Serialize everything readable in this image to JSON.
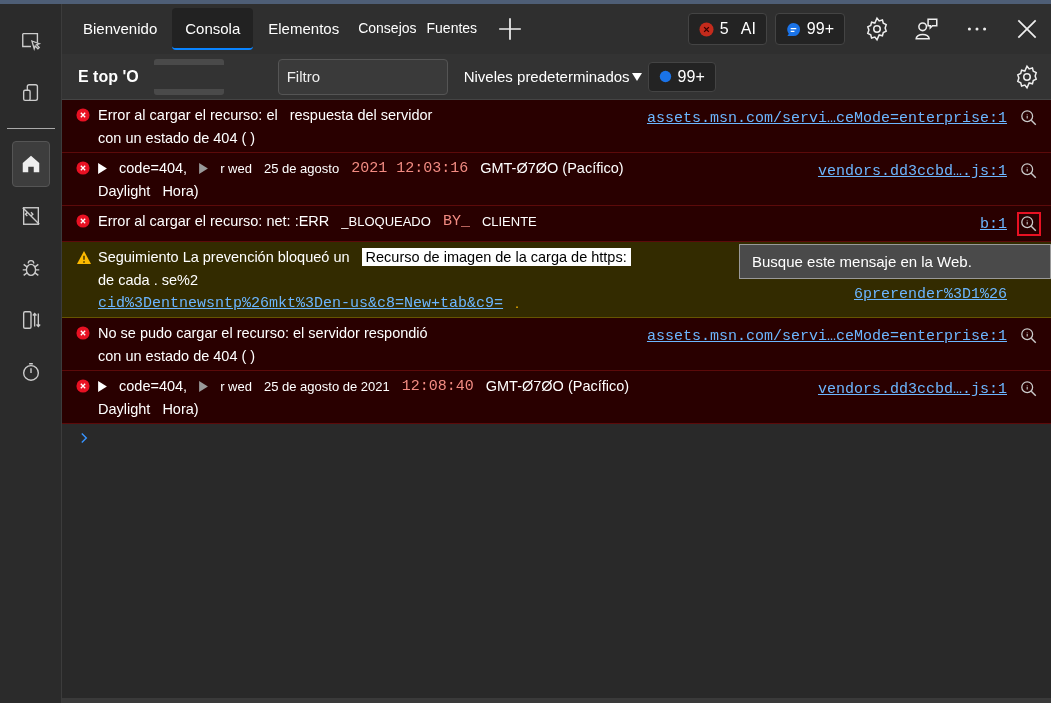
{
  "sidebar": {
    "items": [
      {
        "kind": "inspect",
        "selected": false
      },
      {
        "kind": "device",
        "selected": false
      },
      {
        "kind": "home",
        "selected": true
      },
      {
        "kind": "elements",
        "selected": false
      },
      {
        "kind": "bug",
        "selected": false
      },
      {
        "kind": "network",
        "selected": false
      },
      {
        "kind": "performance",
        "selected": false
      }
    ]
  },
  "tabs": [
    {
      "label": "Bienvenido",
      "selected": false
    },
    {
      "label": "Consola",
      "selected": true
    },
    {
      "label": "Elementos",
      "selected": false
    },
    {
      "label": "Consejos",
      "selected": false
    },
    {
      "label": "Fuentes",
      "selected": false
    }
  ],
  "error_badge": {
    "count": "5",
    "label": "AI"
  },
  "message_badge": {
    "count": "99+"
  },
  "toolbar": {
    "context": "E top 'O",
    "filter_placeholder": "Filtro",
    "levels": "Niveles predeterminados",
    "levels_badge": "99+"
  },
  "messages": [
    {
      "kind": "error",
      "search_focused": false,
      "source": "assets.msn.com/servi…ceMode=enterprise:1",
      "lines": [
        [
          {
            "kind": "text",
            "text": "Error al cargar el recurso: el"
          },
          {
            "kind": "text",
            "text": "respuesta del servidor"
          }
        ],
        [
          {
            "kind": "text",
            "text": "con un estado de 404 ( )"
          }
        ]
      ]
    },
    {
      "kind": "error",
      "search_focused": false,
      "source": "vendors.dd3ccbd….js:1",
      "lines": [
        [
          {
            "kind": "expander"
          },
          {
            "kind": "text",
            "text": "code=404,"
          },
          {
            "kind": "expander-dim"
          },
          {
            "kind": "small",
            "text": "r wed"
          },
          {
            "kind": "small",
            "text": "25 de agosto"
          },
          {
            "kind": "date",
            "text": "2021 12:03:16"
          },
          {
            "kind": "text",
            "text": "GMT-Ø7ØO (Pacífico)"
          }
        ],
        [
          {
            "kind": "text",
            "text": "Daylight"
          },
          {
            "kind": "text",
            "text": "Hora)"
          }
        ]
      ]
    },
    {
      "kind": "error",
      "search_focused": true,
      "source": "b:1",
      "lines": [
        [
          {
            "kind": "text",
            "text": "Error al cargar el recurso: net: :ERR"
          },
          {
            "kind": "small",
            "text": "_BLOQUEADO"
          },
          {
            "kind": "date",
            "text": "BY_"
          },
          {
            "kind": "small",
            "text": "CLIENTE"
          }
        ]
      ]
    },
    {
      "kind": "warning",
      "source": "6prerender%3D1%26",
      "lines": [
        [
          {
            "kind": "text",
            "text": "Seguimiento  La prevención bloqueó un"
          },
          {
            "kind": "highlight",
            "text": "Recurso de imagen de la carga de https:"
          }
        ],
        [
          {
            "kind": "text",
            "text": "de cada . se%2"
          }
        ],
        [
          {
            "kind": "link",
            "text": "cid%3Dentnewsntp%26mkt%3Den-us&c8=New+tab&c9="
          },
          {
            "kind": "dot",
            "text": "."
          }
        ]
      ]
    },
    {
      "kind": "error",
      "search_focused": false,
      "source": "assets.msn.com/servi…ceMode=enterprise:1",
      "lines": [
        [
          {
            "kind": "text",
            "text": "No se pudo cargar el recurso: el servidor respondió"
          }
        ],
        [
          {
            "kind": "text",
            "text": "con un estado de 404 ( )"
          }
        ]
      ]
    },
    {
      "kind": "error",
      "search_focused": false,
      "source": "vendors.dd3ccbd….js:1",
      "lines": [
        [
          {
            "kind": "expander"
          },
          {
            "kind": "text",
            "text": "code=404,"
          },
          {
            "kind": "expander-dim"
          },
          {
            "kind": "small",
            "text": "r wed"
          },
          {
            "kind": "small",
            "text": "25 de agosto de 2021"
          },
          {
            "kind": "date",
            "text": "12:08:40"
          },
          {
            "kind": "text",
            "text": "GMT-Ø7ØO (Pacífico)"
          }
        ],
        [
          {
            "kind": "text",
            "text": "Daylight"
          },
          {
            "kind": "text",
            "text": "Hora)"
          }
        ]
      ]
    }
  ],
  "tooltip": "Busque este mensaje en la Web."
}
